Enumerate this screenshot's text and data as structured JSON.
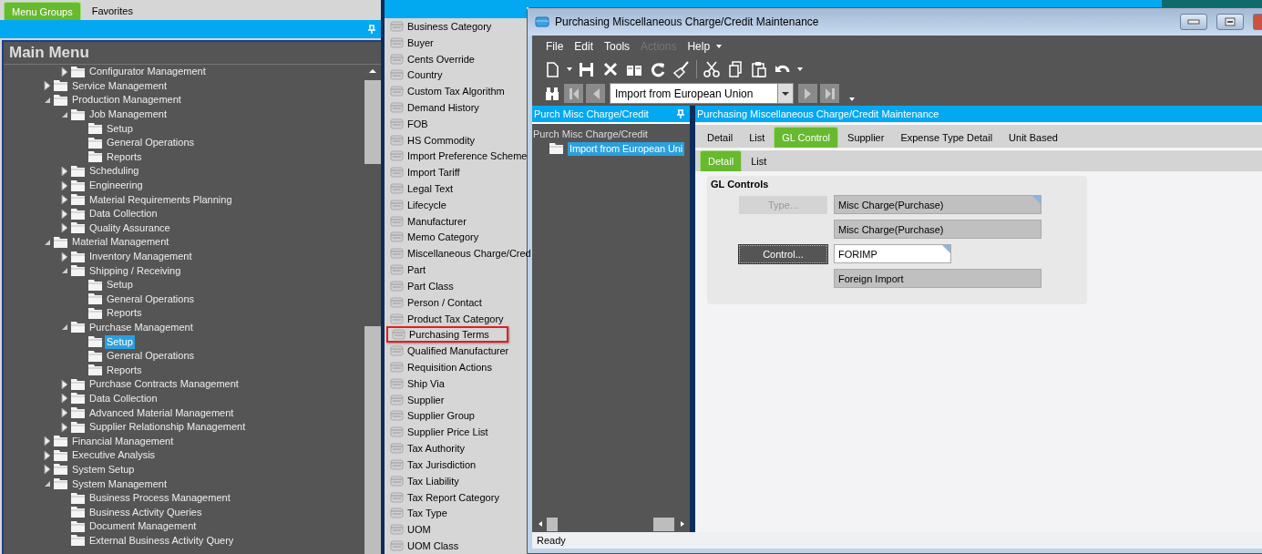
{
  "menu_panel": {
    "tabs": [
      {
        "label": "Menu Groups",
        "selected": true
      },
      {
        "label": "Favorites",
        "selected": false
      }
    ],
    "title": "Main Menu",
    "tree": [
      {
        "children": [
          {
            "label": "Configurator Management",
            "expanded": false,
            "selected": false
          }
        ]
      },
      {
        "label": "Service Management",
        "expanded": false,
        "selected": false
      },
      {
        "label": "Production Management",
        "expanded": true,
        "selected": false,
        "children": [
          {
            "label": "Job Management",
            "expanded": true,
            "selected": false,
            "children": [
              {
                "label": "Setup",
                "selected": false
              },
              {
                "label": "General Operations",
                "selected": false
              },
              {
                "label": "Reports",
                "selected": false
              }
            ]
          },
          {
            "label": "Scheduling",
            "expanded": false,
            "selected": false
          },
          {
            "label": "Engineering",
            "expanded": false,
            "selected": false
          },
          {
            "label": "Material Requirements Planning",
            "expanded": false,
            "selected": false
          },
          {
            "label": "Data Collection",
            "expanded": false,
            "selected": false
          },
          {
            "label": "Quality Assurance",
            "expanded": false,
            "selected": false
          }
        ]
      },
      {
        "label": "Material Management",
        "expanded": true,
        "selected": false,
        "children": [
          {
            "label": "Inventory Management",
            "expanded": false,
            "selected": false
          },
          {
            "label": "Shipping / Receiving",
            "expanded": true,
            "selected": false,
            "children": [
              {
                "label": "Setup",
                "selected": false
              },
              {
                "label": "General Operations",
                "selected": false
              },
              {
                "label": "Reports",
                "selected": false
              }
            ]
          },
          {
            "label": "Purchase Management",
            "expanded": true,
            "selected": false,
            "children": [
              {
                "label": "Setup",
                "selected": true
              },
              {
                "label": "General Operations",
                "selected": false
              },
              {
                "label": "Reports",
                "selected": false
              }
            ]
          },
          {
            "label": "Purchase Contracts Management",
            "expanded": false,
            "selected": false
          },
          {
            "label": "Data Collection",
            "expanded": false,
            "selected": false
          },
          {
            "label": "Advanced Material Management",
            "expanded": false,
            "selected": false
          },
          {
            "label": "Supplier Relationship Management",
            "expanded": false,
            "selected": false
          }
        ]
      },
      {
        "label": "Financial Management",
        "expanded": false,
        "selected": false
      },
      {
        "label": "Executive Analysis",
        "expanded": false,
        "selected": false
      },
      {
        "label": "System Setup",
        "expanded": false,
        "selected": false
      },
      {
        "label": "System Management",
        "expanded": true,
        "selected": false,
        "children": [
          {
            "label": "Business Process Management",
            "selected": false
          },
          {
            "label": "Business Activity Queries",
            "selected": false
          },
          {
            "label": "Document Management",
            "selected": false
          },
          {
            "label": "External Business Activity Query",
            "selected": false
          }
        ]
      }
    ]
  },
  "setup_list": [
    {
      "label": "Business Category",
      "highlighted": false
    },
    {
      "label": "Buyer",
      "highlighted": false
    },
    {
      "label": "Cents Override",
      "highlighted": false
    },
    {
      "label": "Country",
      "highlighted": false
    },
    {
      "label": "Custom Tax Algorithm",
      "highlighted": false
    },
    {
      "label": "Demand History",
      "highlighted": false
    },
    {
      "label": "FOB",
      "highlighted": false
    },
    {
      "label": "HS Commodity",
      "highlighted": false
    },
    {
      "label": "Import Preference Scheme",
      "highlighted": false
    },
    {
      "label": "Import Tariff",
      "highlighted": false
    },
    {
      "label": "Legal Text",
      "highlighted": false
    },
    {
      "label": "Lifecycle",
      "highlighted": false
    },
    {
      "label": "Manufacturer",
      "highlighted": false
    },
    {
      "label": "Memo Category",
      "highlighted": false
    },
    {
      "label": "Miscellaneous Charge/Cred",
      "highlighted": false
    },
    {
      "label": "Part",
      "highlighted": false
    },
    {
      "label": "Part Class",
      "highlighted": false
    },
    {
      "label": "Person / Contact",
      "highlighted": false
    },
    {
      "label": "Product Tax Category",
      "highlighted": false
    },
    {
      "label": "Purchasing Terms",
      "highlighted": true
    },
    {
      "label": "Qualified Manufacturer",
      "highlighted": false
    },
    {
      "label": "Requisition Actions",
      "highlighted": false
    },
    {
      "label": "Ship Via",
      "highlighted": false
    },
    {
      "label": "Supplier",
      "highlighted": false
    },
    {
      "label": "Supplier Group",
      "highlighted": false
    },
    {
      "label": "Supplier Price List",
      "highlighted": false
    },
    {
      "label": "Tax Authority",
      "highlighted": false
    },
    {
      "label": "Tax Jurisdiction",
      "highlighted": false
    },
    {
      "label": "Tax Liability",
      "highlighted": false
    },
    {
      "label": "Tax Report Category",
      "highlighted": false
    },
    {
      "label": "Tax Type",
      "highlighted": false
    },
    {
      "label": "UOM",
      "highlighted": false
    },
    {
      "label": "UOM Class",
      "highlighted": false
    }
  ],
  "window": {
    "title": "Purchasing Miscellaneous Charge/Credit Maintenance",
    "menu": [
      {
        "label": "File",
        "disabled": false
      },
      {
        "label": "Edit",
        "disabled": false
      },
      {
        "label": "Tools",
        "disabled": false
      },
      {
        "label": "Actions",
        "disabled": true
      },
      {
        "label": "Help",
        "disabled": false
      }
    ],
    "navigator": {
      "value": "Import from European Union"
    },
    "tree_pane": {
      "title": "Purch Misc Charge/Credit",
      "root": "Purch Misc Charge/Credit",
      "children": [
        {
          "label": "Import from European Uni",
          "selected": true
        }
      ]
    },
    "form_pane": {
      "title": "Purchasing Miscellaneous Charge/Credit Maintenance",
      "tabs": [
        {
          "label": "Detail",
          "selected": false
        },
        {
          "label": "List",
          "selected": false
        },
        {
          "label": "GL Control",
          "selected": true
        },
        {
          "label": "Supplier",
          "selected": false
        },
        {
          "label": "Expense Type Detail",
          "selected": false
        },
        {
          "label": "Unit Based",
          "selected": false
        }
      ],
      "subtabs": [
        {
          "label": "Detail",
          "selected": true
        },
        {
          "label": "List",
          "selected": false
        }
      ],
      "group": {
        "title": "GL Controls",
        "rows": [
          {
            "button": {
              "label": "Type...",
              "disabled": true
            },
            "value": "Misc Charge(Purchase)",
            "readonly": true,
            "marked": true
          },
          {
            "value": "Misc Charge(Purchase)",
            "readonly": true,
            "marked": false
          },
          {
            "button": {
              "label": "Control...",
              "disabled": false
            },
            "value": "FORIMP",
            "readonly": false,
            "marked": true
          },
          {
            "value": "Foreign Import",
            "readonly": true,
            "marked": false
          }
        ]
      }
    },
    "status_bar": "Ready"
  }
}
